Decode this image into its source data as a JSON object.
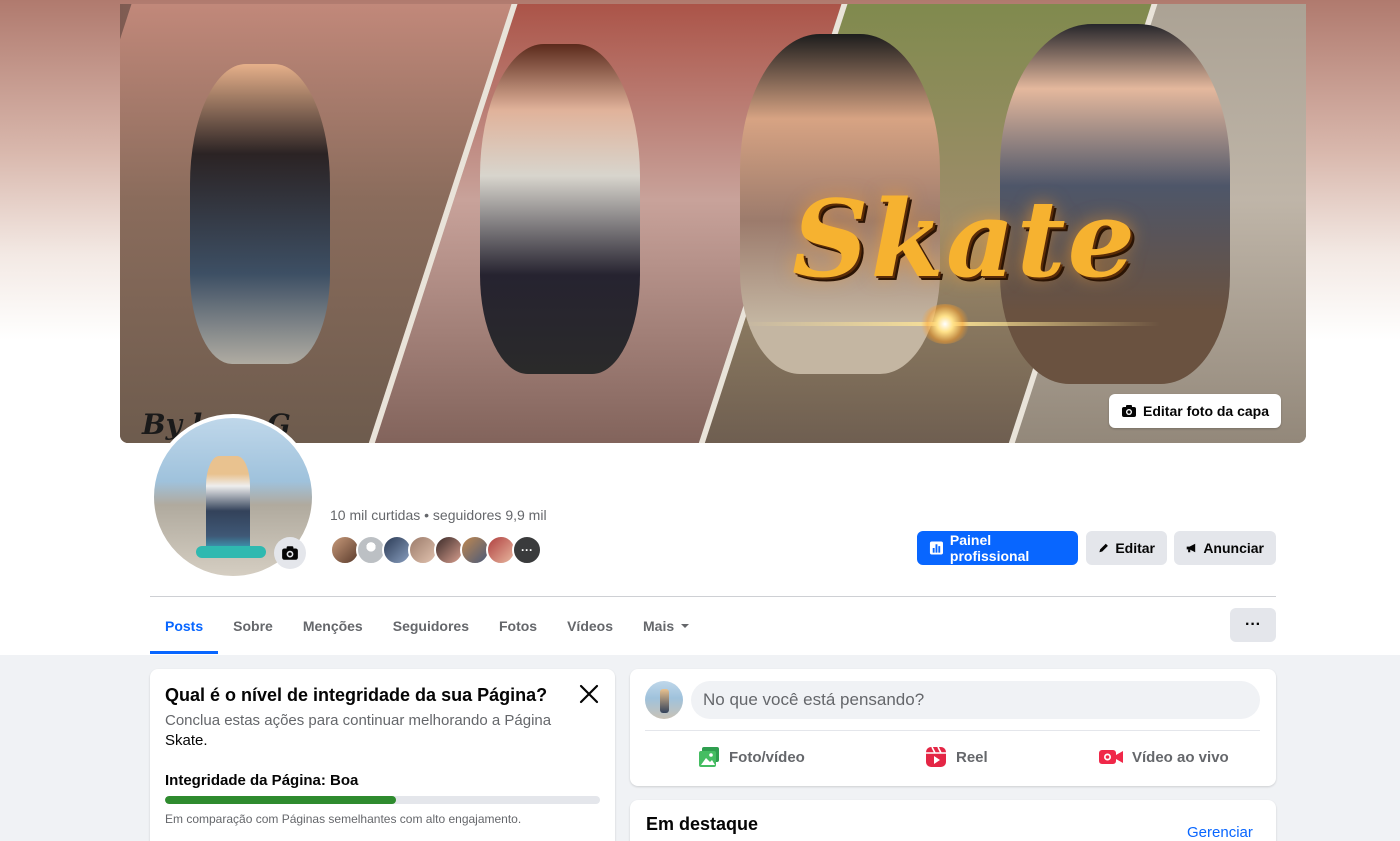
{
  "cover": {
    "title_text": "Skate",
    "signature_text": "By      lous.G",
    "edit_button_label": "Editar foto da capa"
  },
  "profile": {
    "stats": "10 mil curtidas • seguidores 9,9 mil",
    "followers_more": "···"
  },
  "actions": {
    "panel_label": "Painel profissional",
    "edit_label": "Editar",
    "advertise_label": "Anunciar"
  },
  "tabs": {
    "posts": "Posts",
    "about": "Sobre",
    "mentions": "Menções",
    "followers": "Seguidores",
    "photos": "Fotos",
    "videos": "Vídeos",
    "more": "Mais",
    "dots": "···"
  },
  "integrity": {
    "title": "Qual é o nível de integridade da sua Página?",
    "description": "Conclua estas ações para continuar melhorando a Página",
    "page_name": "Skate.",
    "label": "Integridade da Página: Boa",
    "progress": 0.53,
    "note": "Em comparação com Páginas semelhantes com alto engajamento."
  },
  "composer": {
    "placeholder": "No que você está pensando?",
    "photo_video": "Foto/vídeo",
    "reel": "Reel",
    "live": "Vídeo ao vivo"
  },
  "featured": {
    "title": "Em destaque",
    "manage": "Gerenciar"
  },
  "colors": {
    "accent": "#0866ff",
    "progress_green": "#2e8b2e",
    "photo_green": "#45bd62",
    "reel_pink": "#e42645",
    "live_red": "#f02849"
  }
}
